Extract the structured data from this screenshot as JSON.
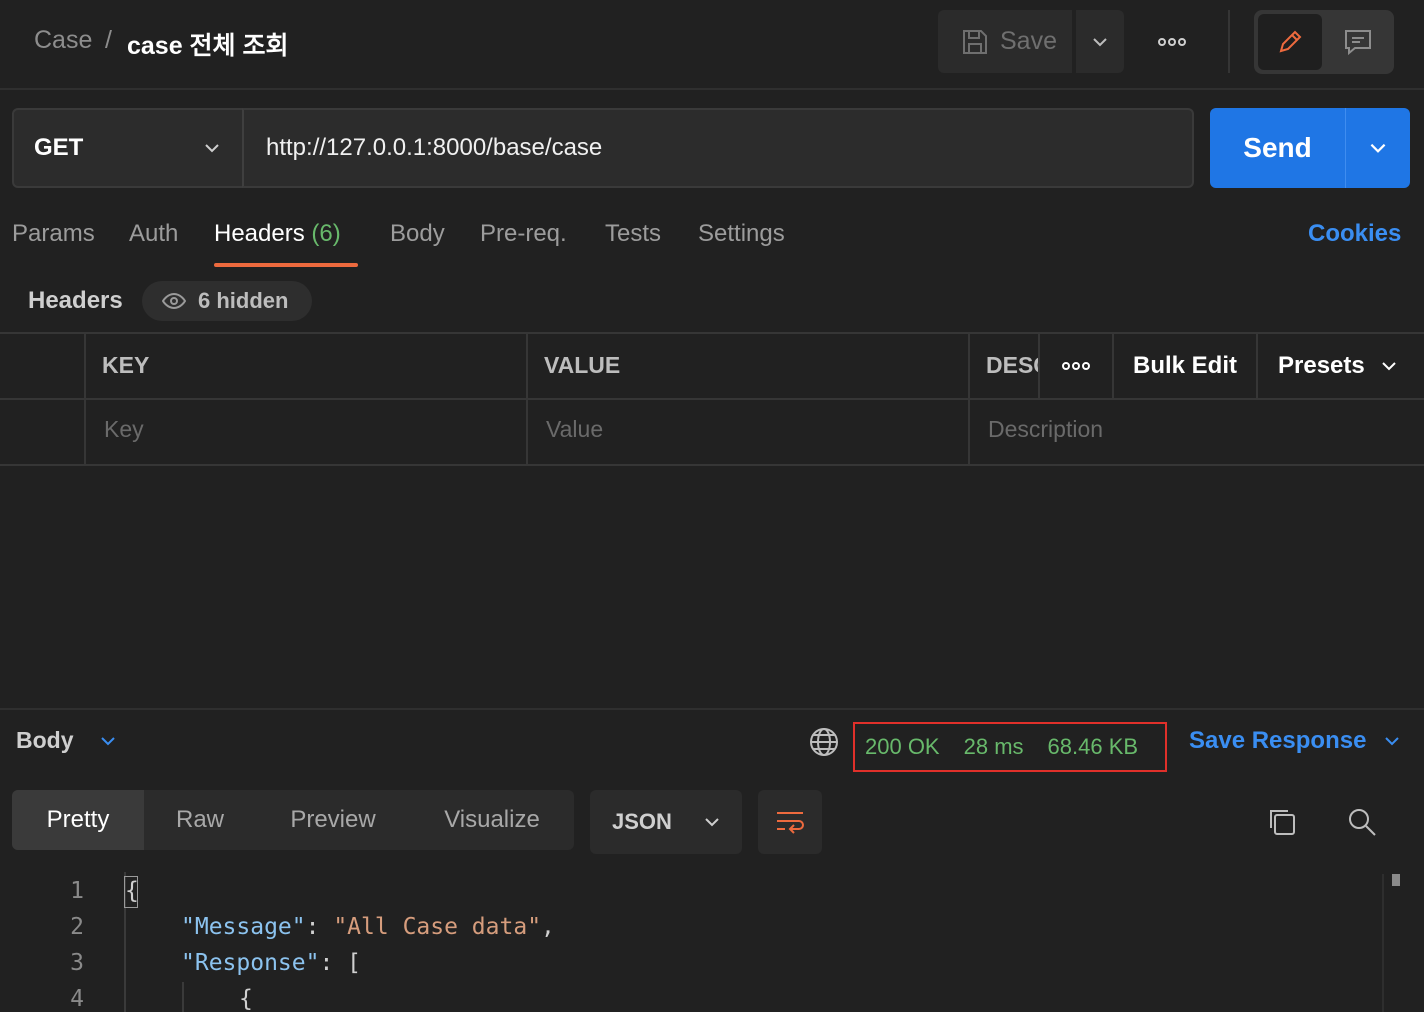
{
  "breadcrumb": {
    "parent": "Case",
    "separator": "/",
    "current": "case 전체 조회"
  },
  "toolbar": {
    "save_label": "Save"
  },
  "request": {
    "method": "GET",
    "url": "http://127.0.0.1:8000/base/case",
    "send_label": "Send"
  },
  "tabs": [
    {
      "label": "Params"
    },
    {
      "label": "Auth"
    },
    {
      "label": "Headers",
      "count": "(6)",
      "active": true
    },
    {
      "label": "Body"
    },
    {
      "label": "Pre-req."
    },
    {
      "label": "Tests"
    },
    {
      "label": "Settings"
    }
  ],
  "cookies_label": "Cookies",
  "headers_section": {
    "title": "Headers",
    "hidden_label": "6 hidden"
  },
  "table": {
    "columns": {
      "key": "KEY",
      "value": "VALUE",
      "description": "DESC"
    },
    "placeholders": {
      "key": "Key",
      "value": "Value",
      "description": "Description"
    },
    "bulk_edit_label": "Bulk Edit",
    "presets_label": "Presets"
  },
  "response": {
    "body_label": "Body",
    "status": "200 OK",
    "time": "28 ms",
    "size": "68.46 KB",
    "save_response_label": "Save Response",
    "view_tabs": [
      "Pretty",
      "Raw",
      "Preview",
      "Visualize"
    ],
    "active_view": "Pretty",
    "format": "JSON",
    "code": {
      "line_numbers": [
        "1",
        "2",
        "3",
        "4"
      ],
      "line1": "{",
      "line2_key": "\"Message\"",
      "line2_colon": ": ",
      "line2_value": "\"All Case data\"",
      "line2_comma": ",",
      "line3_key": "\"Response\"",
      "line3_rest": ": [",
      "line4": "{"
    }
  },
  "colors": {
    "accent": "#1f76e5",
    "status_ok": "#68b96b",
    "highlight_border": "#e0302a",
    "active_tab_underline": "#ed6a3e",
    "link": "#3a8ef2"
  }
}
